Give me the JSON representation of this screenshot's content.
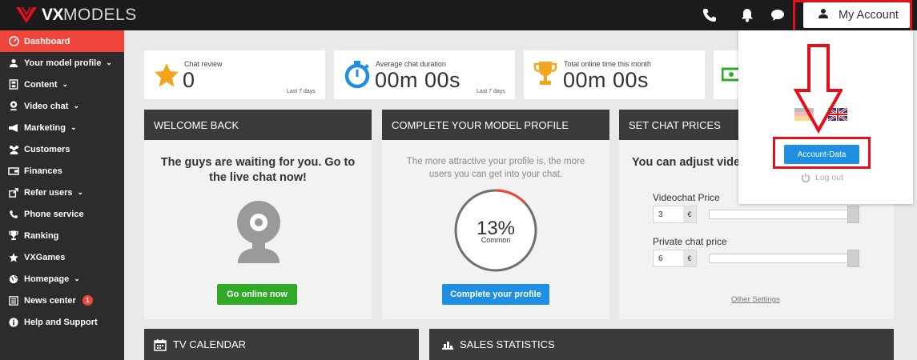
{
  "brand": {
    "bold": "VX",
    "thin": "MODELS",
    "accent": "#e3101b"
  },
  "topbar": {
    "icons": [
      "phone-icon",
      "bell-icon",
      "chat-bubble-icon"
    ],
    "account_label": "My Account"
  },
  "sidebar": {
    "items": [
      {
        "label": "Dashboard",
        "icon": "dashboard-icon",
        "chevron": false,
        "active": true
      },
      {
        "label": "Your model profile",
        "icon": "user-icon",
        "chevron": true
      },
      {
        "label": "Content",
        "icon": "film-icon",
        "chevron": true
      },
      {
        "label": "Video chat",
        "icon": "webcam-icon",
        "chevron": true
      },
      {
        "label": "Marketing",
        "icon": "megaphone-icon",
        "chevron": true
      },
      {
        "label": "Customers",
        "icon": "users-icon",
        "chevron": false
      },
      {
        "label": "Finances",
        "icon": "wallet-icon",
        "chevron": false
      },
      {
        "label": "Refer users",
        "icon": "refer-icon",
        "chevron": true
      },
      {
        "label": "Phone service",
        "icon": "phone-icon",
        "chevron": false
      },
      {
        "label": "Ranking",
        "icon": "trophy-icon",
        "chevron": false
      },
      {
        "label": "VXGames",
        "icon": "star-icon",
        "chevron": false
      },
      {
        "label": "Homepage",
        "icon": "globe-icon",
        "chevron": true
      },
      {
        "label": "News center",
        "icon": "newspaper-icon",
        "chevron": false,
        "badge": "1"
      },
      {
        "label": "Help and Support",
        "icon": "info-icon",
        "chevron": false
      }
    ],
    "chevron_glyph": "⌄"
  },
  "stats": {
    "chat_review": {
      "caption": "Chat review",
      "value": "0",
      "period": "Last 7 days"
    },
    "avg_duration": {
      "caption": "Average chat duration",
      "value": "00m 00s",
      "period": "Last 7 days"
    },
    "online_time": {
      "caption": "Total online time this month",
      "value": "00m 00s"
    }
  },
  "panels": {
    "welcome": {
      "title": "WELCOME BACK",
      "text": "The guys are waiting for you. Go to the live chat now!",
      "button": "Go online now"
    },
    "profile": {
      "title": "COMPLETE YOUR MODEL PROFILE",
      "text": "The more attractive your profile is, the more users you can get into your chat.",
      "percent": "13%",
      "percent_value": 0.13,
      "level": "Common",
      "button": "Complete your profile"
    },
    "prices": {
      "title": "SET CHAT PRICES",
      "text": "You can adjust video",
      "video_label": "Videochat Price",
      "video_value": "3",
      "private_label": "Private chat price",
      "private_value": "6",
      "currency": "€",
      "other_settings": "Other Settings"
    }
  },
  "bottom": {
    "tv_calendar": "TV CALENDAR",
    "sales_statistics": "SALES STATISTICS"
  },
  "dropdown": {
    "flags": [
      "german-flag-icon",
      "uk-flag-icon"
    ],
    "account_data": "Account-Data",
    "logout": "Log out"
  }
}
